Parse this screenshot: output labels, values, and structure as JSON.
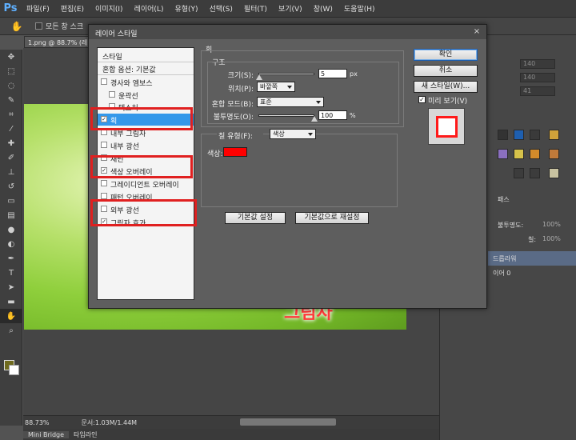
{
  "app": {
    "logo": "Ps",
    "menu": [
      "파일(F)",
      "편집(E)",
      "이미지(I)",
      "레이어(L)",
      "유형(Y)",
      "선택(S)",
      "필터(T)",
      "보기(V)",
      "창(W)",
      "도움말(H)"
    ]
  },
  "options_bar": {
    "tool_icon": "hand-icon",
    "checkbox_label": "모든 창 스크"
  },
  "document": {
    "tab_label": "1.png @ 88.7% (레이",
    "canvas_text": "그림자",
    "zoom": "88.73%",
    "doc_size": "문서:1.03M/1.44M"
  },
  "bottom_tabs": [
    "Mini Bridge",
    "타임라인"
  ],
  "right_panel": {
    "values": [
      "140",
      "140",
      "41"
    ],
    "layers_tab": "패스",
    "opacity_label": "불투명도:",
    "opacity_value": "100%",
    "fill_label": "칠:",
    "fill_value": "100%",
    "layer_rows": [
      "드롭라워",
      "이어 0"
    ]
  },
  "dialog": {
    "title": "레이어 스타일",
    "close": "×",
    "style_list": {
      "header": "스타일",
      "blend_options": "혼합 옵션: 기본값",
      "items": [
        {
          "label": "경사와 엠보스",
          "checked": false,
          "level": 0
        },
        {
          "label": "윤곽선",
          "checked": false,
          "level": 1
        },
        {
          "label": "텍스처",
          "checked": false,
          "level": 1
        },
        {
          "label": "획",
          "checked": true,
          "level": 0,
          "selected": true
        },
        {
          "label": "내부 그림자",
          "checked": false,
          "level": 0
        },
        {
          "label": "내부 광선",
          "checked": false,
          "level": 0
        },
        {
          "label": "새틴",
          "checked": false,
          "level": 0
        },
        {
          "label": "색상 오버레이",
          "checked": true,
          "level": 0
        },
        {
          "label": "그레이디언트 오버레이",
          "checked": false,
          "level": 0
        },
        {
          "label": "패턴 오버레이",
          "checked": false,
          "level": 0
        },
        {
          "label": "외부 광선",
          "checked": false,
          "level": 0
        },
        {
          "label": "그림자 효과",
          "checked": true,
          "level": 0
        }
      ]
    },
    "stroke": {
      "group_title": "획",
      "structure_title": "구조",
      "size_label": "크기(S):",
      "size_value": "5",
      "size_unit": "px",
      "position_label": "위치(P):",
      "position_value": "바깥쪽",
      "blend_label": "혼합 모드(B):",
      "blend_value": "표준",
      "opacity_label": "불투명도(O):",
      "opacity_value": "100",
      "opacity_unit": "%",
      "fill_type_label": "칠 유형(F):",
      "fill_type_value": "색상",
      "color_label": "색상:",
      "color": "#ff0000",
      "default_button": "기본값 설정",
      "reset_button": "기본값으로 재설정"
    },
    "buttons": {
      "ok": "확인",
      "cancel": "취소",
      "new_style": "새 스타일(W)...",
      "preview_label": "미리 보기(V)",
      "preview_checked": "✓"
    }
  },
  "colors": {
    "accent_selected": "#3498ea",
    "highlight": "#e02020",
    "foreground": "#6f6a1e"
  }
}
